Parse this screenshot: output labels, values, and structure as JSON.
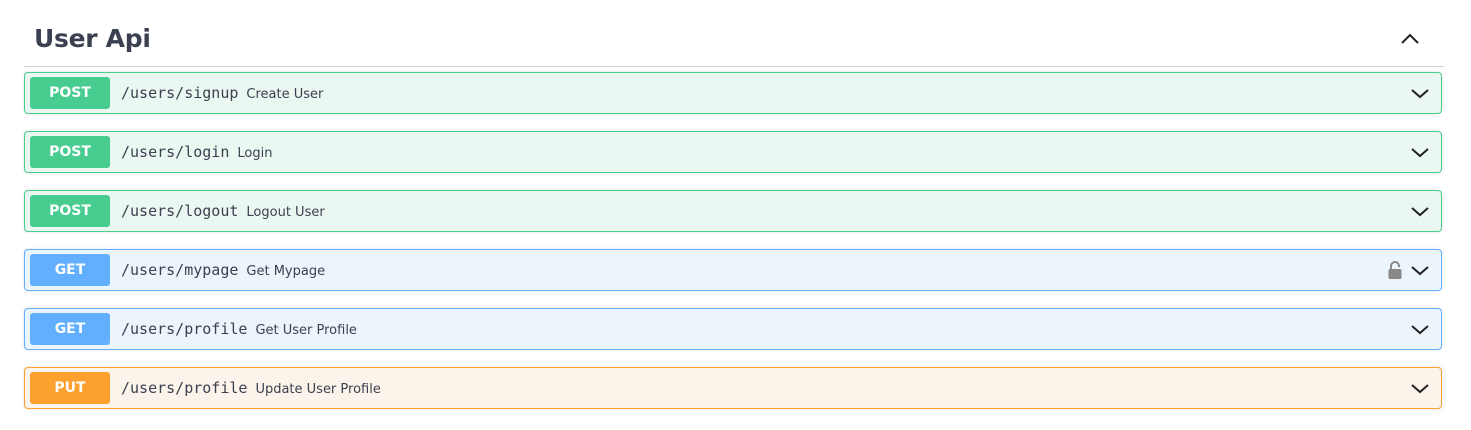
{
  "tag": {
    "title": "User Api",
    "collapse_icon": "chevron-up-icon"
  },
  "operations": [
    {
      "method": "POST",
      "path": "/users/signup",
      "summary": "Create User",
      "locked": false,
      "color": "#49cc90"
    },
    {
      "method": "POST",
      "path": "/users/login",
      "summary": "Login",
      "locked": false,
      "color": "#49cc90"
    },
    {
      "method": "POST",
      "path": "/users/logout",
      "summary": "Logout User",
      "locked": false,
      "color": "#49cc90"
    },
    {
      "method": "GET",
      "path": "/users/mypage",
      "summary": "Get Mypage",
      "locked": true,
      "color": "#61affe"
    },
    {
      "method": "GET",
      "path": "/users/profile",
      "summary": "Get User Profile",
      "locked": false,
      "color": "#61affe"
    },
    {
      "method": "PUT",
      "path": "/users/profile",
      "summary": "Update User Profile",
      "locked": false,
      "color": "#fca130"
    }
  ]
}
